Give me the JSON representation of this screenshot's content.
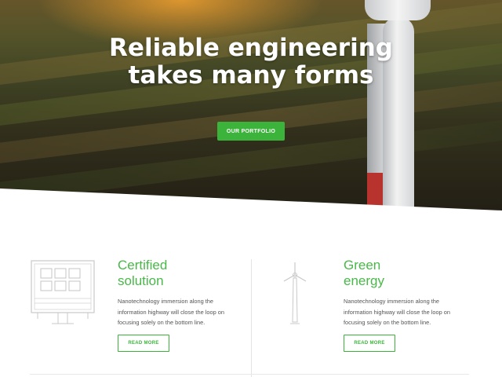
{
  "hero": {
    "title_line1": "Reliable engineering",
    "title_line2": "takes many forms",
    "button_label": "OUR PORTFOLIO"
  },
  "features": [
    {
      "icon": "solar-panel-icon",
      "title_line1": "Certified",
      "title_line2": "solution",
      "text": "Nanotechnology immersion along the information highway will close the loop on focusing solely on the bottom line.",
      "button_label": "READ MORE"
    },
    {
      "icon": "wind-turbine-icon",
      "title_line1": "Green",
      "title_line2": "energy",
      "text": "Nanotechnology immersion along the information highway will close the loop on focusing solely on the bottom line.",
      "button_label": "READ MORE"
    }
  ],
  "colors": {
    "accent": "#3cb43c",
    "title_green": "#49b849",
    "body_text": "#555555"
  }
}
